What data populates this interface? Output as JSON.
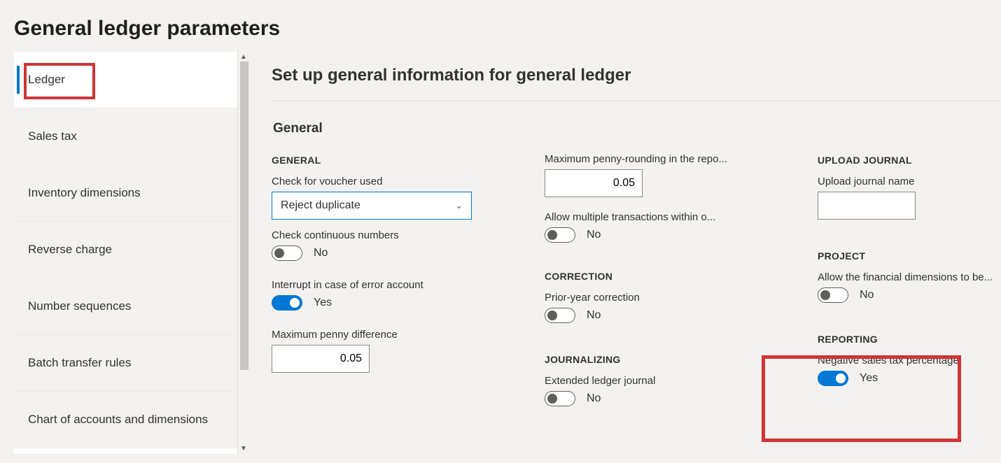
{
  "page": {
    "title": "General ledger parameters"
  },
  "sidebar": {
    "items": [
      {
        "label": "Ledger",
        "active": true
      },
      {
        "label": "Sales tax"
      },
      {
        "label": "Inventory dimensions"
      },
      {
        "label": "Reverse charge"
      },
      {
        "label": "Number sequences"
      },
      {
        "label": "Batch transfer rules"
      },
      {
        "label": "Chart of accounts and dimensions"
      }
    ]
  },
  "main": {
    "title": "Set up general information for general ledger",
    "section": "General",
    "col1": {
      "heading": "GENERAL",
      "check_voucher_label": "Check for voucher used",
      "check_voucher_value": "Reject duplicate",
      "check_continuous_label": "Check continuous numbers",
      "check_continuous_value": "No",
      "interrupt_label": "Interrupt in case of error account",
      "interrupt_value": "Yes",
      "max_penny_diff_label": "Maximum penny difference",
      "max_penny_diff_value": "0.05"
    },
    "col2": {
      "max_penny_round_label": "Maximum penny-rounding in the repo...",
      "max_penny_round_value": "0.05",
      "allow_multi_label": "Allow multiple transactions within o...",
      "allow_multi_value": "No",
      "correction_heading": "CORRECTION",
      "prior_year_label": "Prior-year correction",
      "prior_year_value": "No",
      "journalizing_heading": "JOURNALIZING",
      "ext_ledger_label": "Extended ledger journal",
      "ext_ledger_value": "No"
    },
    "col3": {
      "upload_heading": "UPLOAD JOURNAL",
      "upload_name_label": "Upload journal name",
      "upload_name_value": "",
      "project_heading": "PROJECT",
      "allow_fin_dim_label": "Allow the financial dimensions to be...",
      "allow_fin_dim_value": "No",
      "reporting_heading": "REPORTING",
      "neg_sales_tax_label": "Negative sales tax percentage",
      "neg_sales_tax_value": "Yes"
    }
  }
}
